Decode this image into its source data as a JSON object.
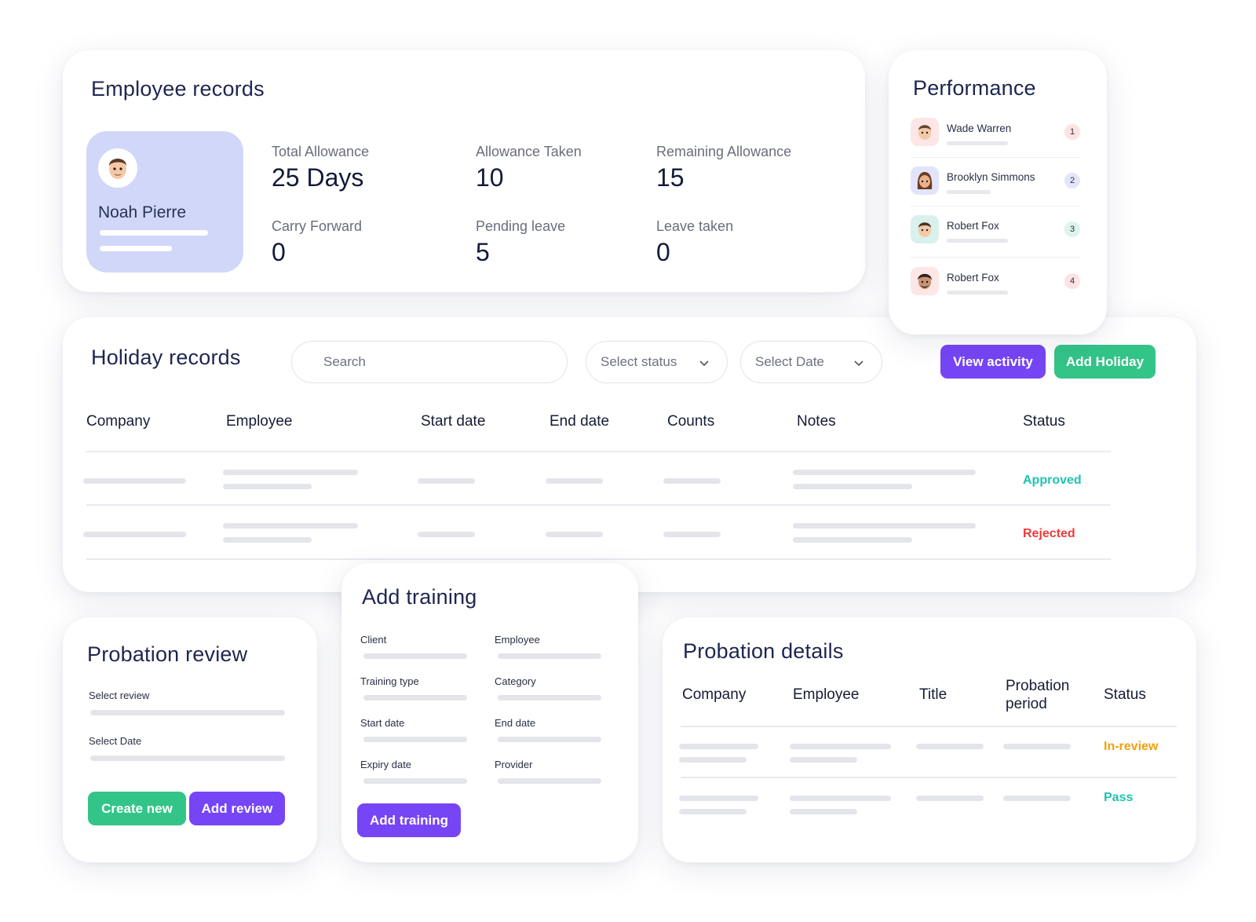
{
  "employee_records": {
    "title": "Employee records",
    "profile_name": "Noah Pierre",
    "stats": [
      {
        "label": "Total Allowance",
        "value": "25 Days"
      },
      {
        "label": "Allowance Taken",
        "value": "10"
      },
      {
        "label": "Remaining Allowance",
        "value": "15"
      },
      {
        "label": "Carry Forward",
        "value": "0"
      },
      {
        "label": "Pending leave",
        "value": "5"
      },
      {
        "label": "Leave taken",
        "value": "0"
      }
    ]
  },
  "performance": {
    "title": "Performance",
    "items": [
      {
        "name": "Wade Warren",
        "rank": "1",
        "rank_color": "#fde3e3",
        "avatar_bg": "#fde6e6"
      },
      {
        "name": "Brooklyn Simmons",
        "rank": "2",
        "rank_color": "#e3e6fb",
        "avatar_bg": "#e1e4fb"
      },
      {
        "name": "Robert Fox",
        "rank": "3",
        "rank_color": "#dcf3ee",
        "avatar_bg": "#d9f1ec"
      },
      {
        "name": "Robert Fox",
        "rank": "4",
        "rank_color": "#fde3e3",
        "avatar_bg": "#fde6e6"
      }
    ]
  },
  "holiday_records": {
    "title": "Holiday records",
    "search_placeholder": "Search",
    "status_select": "Select status",
    "date_select": "Select Date",
    "view_activity": "View activity",
    "add_holiday": "Add Holiday",
    "columns": [
      "Company",
      "Employee",
      "Start date",
      "End date",
      "Counts",
      "Notes",
      "Status"
    ],
    "rows": [
      {
        "status": "Approved"
      },
      {
        "status": "Rejected"
      }
    ]
  },
  "probation_review": {
    "title": "Probation review",
    "select_review": "Select review",
    "select_date": "Select Date",
    "create_new": "Create new",
    "add_review": "Add review"
  },
  "add_training": {
    "title": "Add training",
    "fields": [
      "Client",
      "Employee",
      "Training type",
      "Category",
      "Start date",
      "End date",
      "Expiry date",
      "Provider"
    ],
    "button": "Add training"
  },
  "probation_details": {
    "title": "Probation details",
    "columns": [
      "Company",
      "Employee",
      "Title",
      "Probation period",
      "Status"
    ],
    "rows": [
      {
        "status": "In-review"
      },
      {
        "status": "Pass"
      }
    ]
  },
  "colors": {
    "accent_purple": "#7645f5",
    "accent_green": "#33c488",
    "approved": "#1fc3b0",
    "rejected": "#ef3b3b",
    "in_review": "#f5a00b",
    "pass": "#1fc3b0"
  }
}
